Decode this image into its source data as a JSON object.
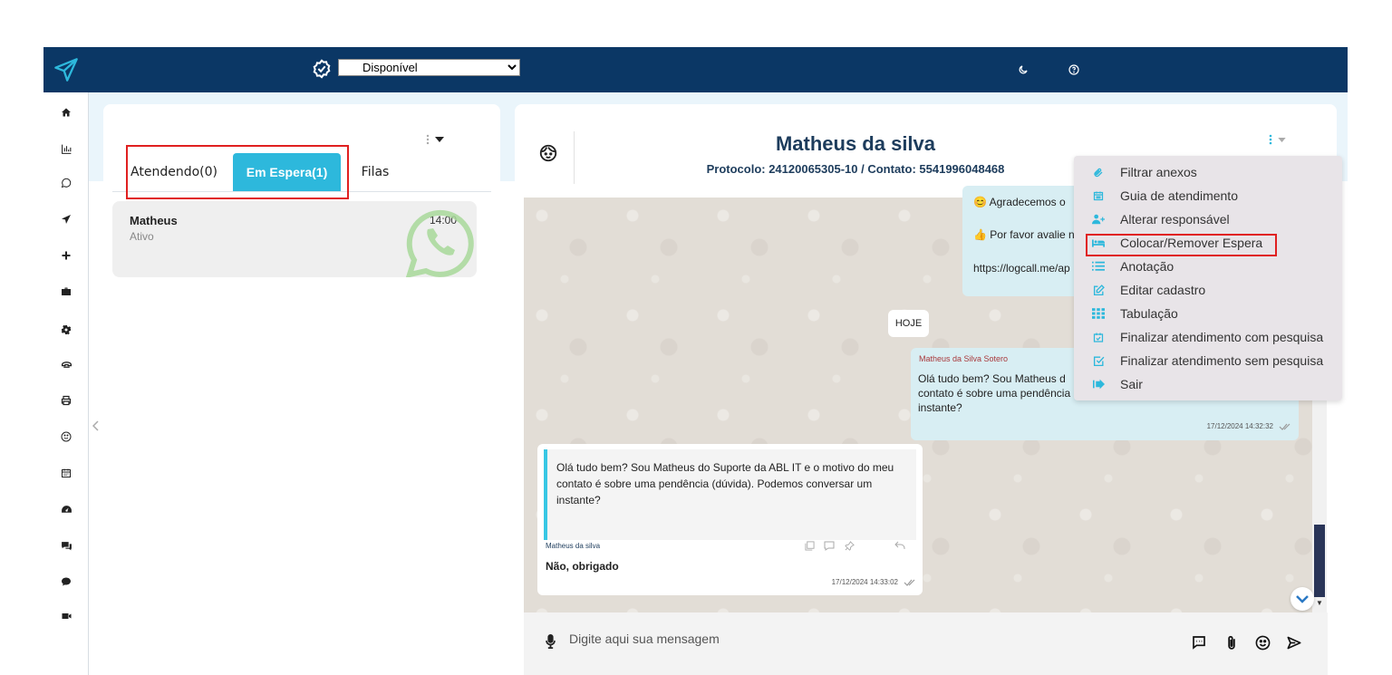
{
  "topbar": {
    "status_value": "Disponível",
    "status_options": [
      "Disponível"
    ],
    "brand_color": "#0b3765"
  },
  "sidebar": {
    "items": [
      {
        "icon": "home-icon"
      },
      {
        "icon": "chart-icon"
      },
      {
        "icon": "whatsapp-icon"
      },
      {
        "icon": "send-icon"
      },
      {
        "icon": "plus-icon"
      },
      {
        "icon": "briefcase-icon"
      },
      {
        "icon": "gear-icon"
      },
      {
        "icon": "headset-icon"
      },
      {
        "icon": "printer-icon"
      },
      {
        "icon": "smile-icon"
      },
      {
        "icon": "calendar-icon"
      },
      {
        "icon": "dashboard-icon"
      },
      {
        "icon": "comments-icon"
      },
      {
        "icon": "chat-bubble-icon"
      },
      {
        "icon": "video-icon"
      }
    ]
  },
  "left_panel": {
    "tabs": [
      {
        "label": "Atendendo(0)",
        "active": false
      },
      {
        "label": "Em Espera(1)",
        "active": true
      },
      {
        "label": "Filas",
        "active": false
      }
    ],
    "chats": [
      {
        "name": "Matheus",
        "status": "Ativo",
        "time": "14:00",
        "channel_icon": "whatsapp-icon"
      }
    ]
  },
  "chat": {
    "contact_name": "Matheus da silva",
    "protocol_line": "Protocolo: 24120065305-10 / Contato: 5541996048468",
    "messages": [
      {
        "direction": "out",
        "lines": [
          "Agradecemos o",
          "Por favor avalie n",
          "https://logcall.me/ap"
        ]
      },
      {
        "type": "day",
        "label": "HOJE"
      },
      {
        "direction": "out",
        "sender": "Matheus da Silva Sotero",
        "text": "Olá tudo bem? Sou Matheus d contato é sobre uma pendência instante?",
        "time": "17/12/2024 14:32:32"
      },
      {
        "direction": "in",
        "quote": "Olá tudo bem? Sou Matheus  do Suporte da ABL IT e o motivo do meu contato é sobre uma pendência (dúvida). Podemos conversar um instante?",
        "sender": "Matheus da silva",
        "text": "Não, obrigado",
        "time": "17/12/2024 14:33:02"
      }
    ],
    "composer_placeholder": "Digite aqui sua mensagem"
  },
  "menu": {
    "items": [
      {
        "label": "Filtrar anexos",
        "icon": "paperclip-icon"
      },
      {
        "label": "Guia de atendimento",
        "icon": "calendar-icon"
      },
      {
        "label": "Alterar responsável",
        "icon": "user-plus-icon"
      },
      {
        "label": "Colocar/Remover Espera",
        "icon": "bed-icon"
      },
      {
        "label": "Anotação",
        "icon": "list-icon"
      },
      {
        "label": "Editar cadastro",
        "icon": "edit-icon"
      },
      {
        "label": "Tabulação",
        "icon": "grid-icon"
      },
      {
        "label": "Finalizar atendimento com pesquisa",
        "icon": "calendar-check-icon"
      },
      {
        "label": "Finalizar atendimento sem pesquisa",
        "icon": "check-square-icon"
      },
      {
        "label": "Sair",
        "icon": "sign-out-icon"
      }
    ],
    "icon_color": "#2db8dc"
  }
}
